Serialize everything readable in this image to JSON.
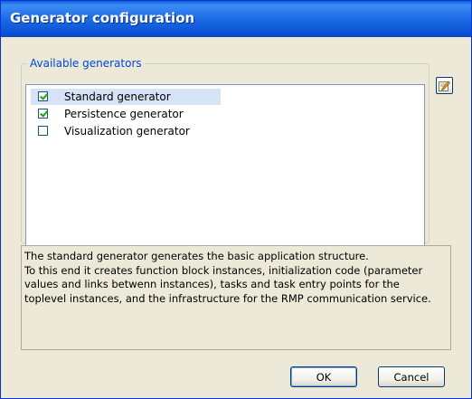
{
  "window": {
    "title": "Generator configuration"
  },
  "generators": {
    "legend": "Available generators",
    "items": [
      {
        "label": "Standard generator",
        "checked": true,
        "selected": true
      },
      {
        "label": "Persistence generator",
        "checked": true,
        "selected": false
      },
      {
        "label": "Visualization generator",
        "checked": false,
        "selected": false
      }
    ],
    "edit_icon": "edit-icon"
  },
  "description": {
    "lines": [
      "The standard generator generates the basic application structure.",
      "To this end it creates function block instances, initialization code (parameter",
      "values and links betwenn instances), tasks and task entry points for the",
      "toplevel instances, and  the infrastructure for the RMP communication service."
    ]
  },
  "buttons": {
    "ok": "OK",
    "cancel": "Cancel"
  }
}
